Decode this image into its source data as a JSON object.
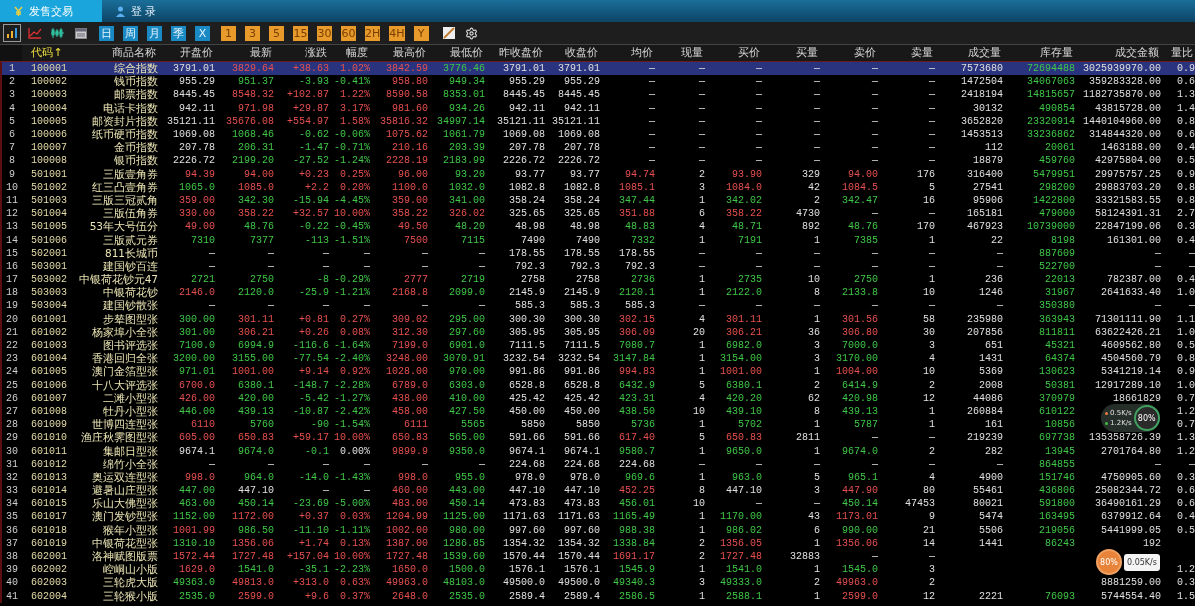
{
  "tabs": [
    {
      "label": "发售交易",
      "selected": true
    },
    {
      "label": "登 录",
      "selected": false
    }
  ],
  "toolbar": {
    "periods": [
      {
        "label": "日",
        "kind": "day"
      },
      {
        "label": "周",
        "kind": "day"
      },
      {
        "label": "月",
        "kind": "day"
      },
      {
        "label": "季",
        "kind": "day"
      },
      {
        "label": "X",
        "kind": "day"
      },
      {
        "label": "1",
        "kind": "minute"
      },
      {
        "label": "3",
        "kind": "minute"
      },
      {
        "label": "5",
        "kind": "minute"
      },
      {
        "label": "15",
        "kind": "minute"
      },
      {
        "label": "30",
        "kind": "minute"
      },
      {
        "label": "60",
        "kind": "minute"
      },
      {
        "label": "2H",
        "kind": "minute"
      },
      {
        "label": "4H",
        "kind": "minute"
      },
      {
        "label": "Y",
        "kind": "minute"
      }
    ]
  },
  "table": {
    "columns": [
      {
        "kind": "index"
      },
      {
        "label": "代码↑",
        "sorted": true
      },
      {
        "label": "商品名称",
        "sorted": false
      },
      {
        "label": "开盘价",
        "sorted": false
      },
      {
        "label": "最新",
        "sorted": false
      },
      {
        "label": "涨跌",
        "sorted": false
      },
      {
        "label": "幅度",
        "sorted": false
      },
      {
        "label": "最高价",
        "sorted": false
      },
      {
        "label": "最低价",
        "sorted": false
      },
      {
        "label": "昨收盘价",
        "sorted": false
      },
      {
        "label": "收盘价",
        "sorted": false
      },
      {
        "label": "均价",
        "sorted": false
      },
      {
        "label": "现量",
        "sorted": false
      },
      {
        "label": "买价",
        "sorted": false
      },
      {
        "label": "买量",
        "sorted": false
      },
      {
        "label": "卖价",
        "sorted": false
      },
      {
        "label": "卖量",
        "sorted": false
      },
      {
        "label": "成交量",
        "sorted": false
      },
      {
        "label": "库存量",
        "sorted": false
      },
      {
        "label": "成交金额",
        "sorted": false
      },
      {
        "label": "量比",
        "sorted": false
      }
    ],
    "rows": [
      {
        "selected": true,
        "cells": [
          "1",
          "100001",
          "综合指数",
          "3791.01",
          "3829.64",
          "+38.63",
          "1.02%",
          "3842.59",
          "3776.46",
          "3791.01",
          "3791.01",
          "—",
          "—",
          "—",
          "—",
          "—",
          "—",
          "7573680",
          "72694488",
          "3025939970.00",
          "0.9"
        ]
      },
      {
        "selected": false,
        "cells": [
          "2",
          "100002",
          "钱币指数",
          "955.29",
          "951.37",
          "-3.93",
          "-0.41%",
          "958.80",
          "949.34",
          "955.29",
          "955.29",
          "—",
          "—",
          "—",
          "—",
          "—",
          "—",
          "1472504",
          "34067063",
          "359283328.00",
          "0.6"
        ]
      },
      {
        "selected": false,
        "cells": [
          "3",
          "100003",
          "邮票指数",
          "8445.45",
          "8548.32",
          "+102.87",
          "1.22%",
          "8590.58",
          "8353.01",
          "8445.45",
          "8445.45",
          "—",
          "—",
          "—",
          "—",
          "—",
          "—",
          "2418194",
          "14815657",
          "1182735870.00",
          "1.3"
        ]
      },
      {
        "selected": false,
        "cells": [
          "4",
          "100004",
          "电话卡指数",
          "942.11",
          "971.98",
          "+29.87",
          "3.17%",
          "981.60",
          "934.26",
          "942.11",
          "942.11",
          "—",
          "—",
          "—",
          "—",
          "—",
          "—",
          "30132",
          "490854",
          "43815728.00",
          "1.4"
        ]
      },
      {
        "selected": false,
        "cells": [
          "5",
          "100005",
          "邮资封片指数",
          "35121.11",
          "35676.08",
          "+554.97",
          "1.58%",
          "35816.32",
          "34997.14",
          "35121.11",
          "35121.11",
          "—",
          "—",
          "—",
          "—",
          "—",
          "—",
          "3652820",
          "23320914",
          "1440104960.00",
          "0.8"
        ]
      },
      {
        "selected": false,
        "cells": [
          "6",
          "100006",
          "纸币硬币指数",
          "1069.08",
          "1068.46",
          "-0.62",
          "-0.06%",
          "1075.62",
          "1061.79",
          "1069.08",
          "1069.08",
          "—",
          "—",
          "—",
          "—",
          "—",
          "—",
          "1453513",
          "33236862",
          "314844320.00",
          "0.6"
        ]
      },
      {
        "selected": false,
        "cells": [
          "7",
          "100007",
          "金币指数",
          "207.78",
          "206.31",
          "-1.47",
          "-0.71%",
          "210.16",
          "203.39",
          "207.78",
          "207.78",
          "—",
          "—",
          "—",
          "—",
          "—",
          "—",
          "112",
          "20061",
          "1463188.00",
          "0.4"
        ]
      },
      {
        "selected": false,
        "cells": [
          "8",
          "100008",
          "银币指数",
          "2226.72",
          "2199.20",
          "-27.52",
          "-1.24%",
          "2228.19",
          "2183.99",
          "2226.72",
          "2226.72",
          "—",
          "—",
          "—",
          "—",
          "—",
          "—",
          "18879",
          "459760",
          "42975804.00",
          "0.5"
        ]
      },
      {
        "selected": false,
        "cells": [
          "9",
          "501001",
          "三版壹角券",
          "94.39",
          "94.00",
          "+0.23",
          "0.25%",
          "96.00",
          "93.20",
          "93.77",
          "93.77",
          "94.74",
          "2",
          "93.90",
          "329",
          "94.00",
          "176",
          "316400",
          "5479951",
          "29975757.25",
          "0.9"
        ]
      },
      {
        "selected": false,
        "cells": [
          "10",
          "501002",
          "红三凸壹角券",
          "1065.0",
          "1085.0",
          "+2.2",
          "0.20%",
          "1100.0",
          "1032.0",
          "1082.8",
          "1082.8",
          "1085.1",
          "3",
          "1084.0",
          "42",
          "1084.5",
          "5",
          "27541",
          "298200",
          "29883703.20",
          "0.8"
        ]
      },
      {
        "selected": false,
        "cells": [
          "11",
          "501003",
          "三版三冠贰角",
          "359.00",
          "342.30",
          "-15.94",
          "-4.45%",
          "359.00",
          "341.00",
          "358.24",
          "358.24",
          "347.44",
          "1",
          "342.02",
          "2",
          "342.47",
          "16",
          "95906",
          "1422800",
          "33321583.55",
          "0.8"
        ]
      },
      {
        "selected": false,
        "cells": [
          "12",
          "501004",
          "三版伍角券",
          "330.00",
          "358.22",
          "+32.57",
          "10.00%",
          "358.22",
          "326.02",
          "325.65",
          "325.65",
          "351.88",
          "6",
          "358.22",
          "4730",
          "—",
          "—",
          "165181",
          "479000",
          "58124391.31",
          "2.7"
        ]
      },
      {
        "selected": false,
        "cells": [
          "13",
          "501005",
          "53年大号伍分",
          "49.00",
          "48.76",
          "-0.22",
          "-0.45%",
          "49.50",
          "48.20",
          "48.98",
          "48.98",
          "48.83",
          "4",
          "48.71",
          "892",
          "48.76",
          "170",
          "467923",
          "10739000",
          "22847199.06",
          "0.3"
        ]
      },
      {
        "selected": false,
        "cells": [
          "14",
          "501006",
          "三版贰元券",
          "7310",
          "7377",
          "-113",
          "-1.51%",
          "7500",
          "7115",
          "7490",
          "7490",
          "7332",
          "1",
          "7191",
          "1",
          "7385",
          "1",
          "22",
          "8198",
          "161301.00",
          "0.4"
        ]
      },
      {
        "selected": false,
        "cells": [
          "15",
          "502001",
          "811长城币",
          "—",
          "—",
          "—",
          "—",
          "—",
          "—",
          "178.55",
          "178.55",
          "178.55",
          "—",
          "—",
          "—",
          "—",
          "—",
          "—",
          "887609",
          "—",
          "—"
        ]
      },
      {
        "selected": false,
        "cells": [
          "16",
          "503001",
          "建国钞百连",
          "—",
          "—",
          "—",
          "—",
          "—",
          "—",
          "792.3",
          "792.3",
          "792.3",
          "—",
          "—",
          "—",
          "—",
          "—",
          "—",
          "522700",
          "—",
          "—"
        ]
      },
      {
        "selected": false,
        "cells": [
          "17",
          "503002",
          "中银荷花钞元47",
          "2721",
          "2750",
          "-8",
          "-0.29%",
          "2777",
          "2719",
          "2758",
          "2758",
          "2736",
          "1",
          "2735",
          "10",
          "2750",
          "1",
          "236",
          "22013",
          "782387.00",
          "0.4"
        ]
      },
      {
        "selected": false,
        "cells": [
          "18",
          "503003",
          "中银荷花钞",
          "2146.0",
          "2120.0",
          "-25.9",
          "-1.21%",
          "2168.8",
          "2099.0",
          "2145.9",
          "2145.9",
          "2120.1",
          "1",
          "2122.0",
          "8",
          "2133.8",
          "10",
          "1246",
          "31967",
          "2641633.40",
          "1.0"
        ]
      },
      {
        "selected": false,
        "cells": [
          "19",
          "503004",
          "建国钞散张",
          "—",
          "—",
          "—",
          "—",
          "—",
          "—",
          "585.3",
          "585.3",
          "585.3",
          "—",
          "—",
          "—",
          "—",
          "—",
          "—",
          "350380",
          "—",
          "—"
        ]
      },
      {
        "selected": false,
        "cells": [
          "20",
          "601001",
          "步辇图型张",
          "300.00",
          "301.11",
          "+0.81",
          "0.27%",
          "309.02",
          "295.00",
          "300.30",
          "300.30",
          "302.15",
          "4",
          "301.11",
          "1",
          "301.56",
          "58",
          "235980",
          "363943",
          "71301111.90",
          "1.1"
        ]
      },
      {
        "selected": false,
        "cells": [
          "21",
          "601002",
          "杨家埠小全张",
          "301.00",
          "306.21",
          "+0.26",
          "0.08%",
          "312.30",
          "297.60",
          "305.95",
          "305.95",
          "306.09",
          "20",
          "306.21",
          "36",
          "306.80",
          "30",
          "207856",
          "811811",
          "63622426.21",
          "1.0"
        ]
      },
      {
        "selected": false,
        "cells": [
          "22",
          "601003",
          "图书评选张",
          "7100.0",
          "6994.9",
          "-116.6",
          "-1.64%",
          "7199.0",
          "6901.0",
          "7111.5",
          "7111.5",
          "7080.7",
          "1",
          "6982.0",
          "3",
          "7000.0",
          "3",
          "651",
          "45321",
          "4609562.80",
          "0.5"
        ]
      },
      {
        "selected": false,
        "cells": [
          "23",
          "601004",
          "香港回归全张",
          "3200.00",
          "3155.00",
          "-77.54",
          "-2.40%",
          "3248.00",
          "3070.91",
          "3232.54",
          "3232.54",
          "3147.84",
          "1",
          "3154.00",
          "3",
          "3170.00",
          "4",
          "1431",
          "64374",
          "4504560.79",
          "0.8"
        ]
      },
      {
        "selected": false,
        "cells": [
          "24",
          "601005",
          "澳门金箔型张",
          "971.01",
          "1001.00",
          "+9.14",
          "0.92%",
          "1028.00",
          "970.00",
          "991.86",
          "991.86",
          "994.83",
          "1",
          "1001.00",
          "1",
          "1004.00",
          "10",
          "5369",
          "130623",
          "5341219.14",
          "0.9"
        ]
      },
      {
        "selected": false,
        "cells": [
          "25",
          "601006",
          "十八大评选张",
          "6700.0",
          "6380.1",
          "-148.7",
          "-2.28%",
          "6789.0",
          "6303.0",
          "6528.8",
          "6528.8",
          "6432.9",
          "5",
          "6380.1",
          "2",
          "6414.9",
          "2",
          "2008",
          "50381",
          "12917289.10",
          "1.0"
        ]
      },
      {
        "selected": false,
        "cells": [
          "26",
          "601007",
          "二滩小型张",
          "426.00",
          "420.00",
          "-5.42",
          "-1.27%",
          "438.00",
          "410.00",
          "425.42",
          "425.42",
          "423.31",
          "4",
          "420.20",
          "62",
          "420.98",
          "12",
          "44086",
          "370979",
          "18661829",
          "0.7"
        ]
      },
      {
        "selected": false,
        "cells": [
          "27",
          "601008",
          "牡丹小型张",
          "446.00",
          "439.13",
          "-10.87",
          "-2.42%",
          "458.00",
          "427.50",
          "450.00",
          "450.00",
          "438.50",
          "10",
          "439.10",
          "8",
          "439.13",
          "1",
          "260884",
          "610122",
          null,
          "1.2"
        ]
      },
      {
        "selected": false,
        "cells": [
          "28",
          "601009",
          "世博四连型张",
          "6110",
          "5760",
          "-90",
          "-1.54%",
          "6111",
          "5565",
          "5850",
          "5850",
          "5736",
          "1",
          "5702",
          "1",
          "5787",
          "1",
          "161",
          "10856",
          null,
          "0.7"
        ]
      },
      {
        "selected": false,
        "cells": [
          "29",
          "601010",
          "渔庄秋霁图型张",
          "605.00",
          "650.83",
          "+59.17",
          "10.00%",
          "650.83",
          "565.00",
          "591.66",
          "591.66",
          "617.40",
          "5",
          "650.83",
          "2811",
          "—",
          "—",
          "219239",
          "697738",
          "135358726.39",
          "1.3"
        ]
      },
      {
        "selected": false,
        "cells": [
          "30",
          "601011",
          "集邮日型张",
          "9674.1",
          "9674.0",
          "-0.1",
          "0.00%",
          "9899.9",
          "9350.0",
          "9674.1",
          "9674.1",
          "9580.7",
          "1",
          "9650.0",
          "1",
          "9674.0",
          "2",
          "282",
          "13945",
          "2701764.80",
          "1.2"
        ]
      },
      {
        "selected": false,
        "cells": [
          "31",
          "601012",
          "绵竹小全张",
          "—",
          "—",
          "—",
          "—",
          "—",
          "—",
          "224.68",
          "224.68",
          "224.68",
          "—",
          "—",
          "—",
          "—",
          "—",
          "—",
          "864855",
          "—",
          "—"
        ]
      },
      {
        "selected": false,
        "cells": [
          "32",
          "601013",
          "奥运双连型张",
          "998.0",
          "964.0",
          "-14.0",
          "-1.43%",
          "998.0",
          "955.0",
          "978.0",
          "978.0",
          "969.6",
          "1",
          "963.0",
          "5",
          "965.1",
          "4",
          "4900",
          "151746",
          "4750905.60",
          "0.3"
        ]
      },
      {
        "selected": false,
        "cells": [
          "33",
          "601014",
          "避暑山庄型张",
          "447.00",
          "447.10",
          "—",
          "—",
          "460.00",
          "443.00",
          "447.10",
          "447.10",
          "452.25",
          "8",
          "447.10",
          "3",
          "447.90",
          "80",
          "55461",
          "436806",
          "25082344.72",
          "0.6"
        ]
      },
      {
        "selected": false,
        "cells": [
          "34",
          "601015",
          "乐山大佛型张",
          "463.00",
          "450.14",
          "-23.69",
          "-5.00%",
          "483.00",
          "450.14",
          "473.83",
          "473.83",
          "456.01",
          "10",
          "—",
          "—",
          "450.14",
          "47453",
          "80021",
          "591800",
          "36490161.29",
          "0.6"
        ]
      },
      {
        "selected": false,
        "cells": [
          "35",
          "601017",
          "澳门发钞型张",
          "1152.00",
          "1172.00",
          "+0.37",
          "0.03%",
          "1204.99",
          "1125.00",
          "1171.63",
          "1171.63",
          "1165.49",
          "1",
          "1170.00",
          "43",
          "1173.01",
          "9",
          "5474",
          "163495",
          "6379912.64",
          "0.4"
        ]
      },
      {
        "selected": false,
        "cells": [
          "36",
          "601018",
          "猴年小型张",
          "1001.99",
          "986.50",
          "-11.10",
          "-1.11%",
          "1002.00",
          "980.00",
          "997.60",
          "997.60",
          "988.38",
          "1",
          "986.02",
          "6",
          "990.00",
          "21",
          "5506",
          "219056",
          "5441999.05",
          "0.5"
        ]
      },
      {
        "selected": false,
        "cells": [
          "37",
          "601019",
          "中银荷花型张",
          "1310.10",
          "1356.06",
          "+1.74",
          "0.13%",
          "1387.00",
          "1286.85",
          "1354.32",
          "1354.32",
          "1338.84",
          "2",
          "1356.05",
          "1",
          "1356.06",
          "14",
          "1441",
          "86243",
          "192",
          null
        ]
      },
      {
        "selected": false,
        "cells": [
          "38",
          "602001",
          "洛神赋图版票",
          "1572.44",
          "1727.48",
          "+157.04",
          "10.00%",
          "1727.48",
          "1539.60",
          "1570.44",
          "1570.44",
          "1691.17",
          "2",
          "1727.48",
          "32883",
          "—",
          "—",
          null,
          null,
          null,
          null
        ]
      },
      {
        "selected": false,
        "cells": [
          "39",
          "602002",
          "崆峒山小版",
          "1629.0",
          "1541.0",
          "-35.1",
          "-2.23%",
          "1650.0",
          "1500.0",
          "1576.1",
          "1576.1",
          "1545.9",
          "1",
          "1541.0",
          "1",
          "1545.0",
          "3",
          null,
          null,
          null,
          "1.2"
        ]
      },
      {
        "selected": false,
        "cells": [
          "40",
          "602003",
          "三轮虎大版",
          "49363.0",
          "49813.0",
          "+313.0",
          "0.63%",
          "49963.0",
          "48103.0",
          "49500.0",
          "49500.0",
          "49340.3",
          "3",
          "49333.0",
          "2",
          "49963.0",
          "2",
          null,
          null,
          "8881259.00",
          "0.3"
        ]
      },
      {
        "selected": false,
        "cells": [
          "41",
          "602004",
          "三轮猴小版",
          "2535.0",
          "2599.0",
          "+9.6",
          "0.37%",
          "2648.0",
          "2535.0",
          "2589.4",
          "2589.4",
          "2586.5",
          "1",
          "2588.1",
          "1",
          "2599.0",
          "12",
          "2221",
          "76093",
          "5744554.40",
          "1.5"
        ]
      }
    ]
  },
  "speed_widgets": [
    {
      "upload": "0.5K/s",
      "download": "1.2K/s",
      "usage": "80%"
    },
    {
      "upload": "0.05K/s",
      "usage": "80%"
    }
  ]
}
